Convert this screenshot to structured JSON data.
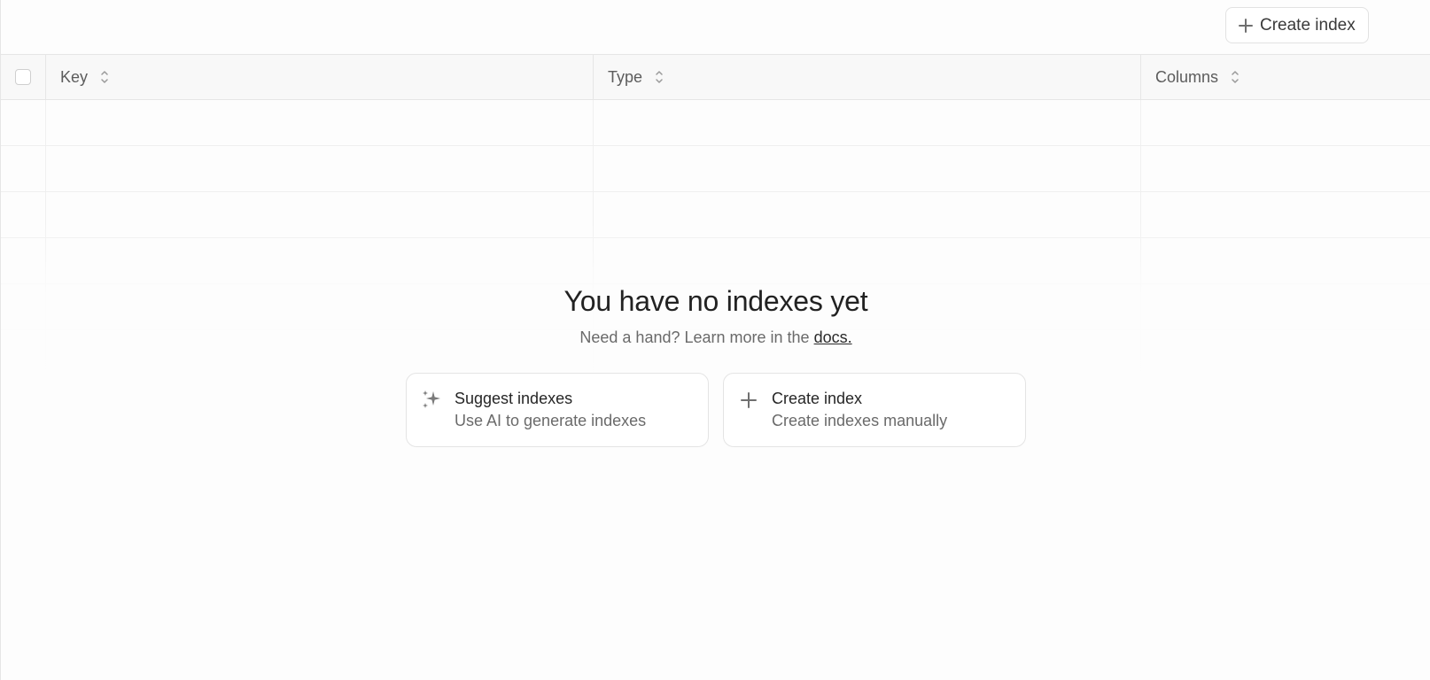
{
  "toolbar": {
    "create_index_label": "Create index",
    "create_index_icon": "plus-icon"
  },
  "table": {
    "columns": [
      {
        "label": "Key",
        "sort_icon": "sort-icon"
      },
      {
        "label": "Type",
        "sort_icon": "sort-icon"
      },
      {
        "label": "Columns",
        "sort_icon": "sort-icon"
      }
    ],
    "rows": []
  },
  "empty_state": {
    "title": "You have no indexes yet",
    "subtitle_prefix": "Need a hand? Learn more in the ",
    "docs_link": "docs.",
    "cards": [
      {
        "title": "Suggest indexes",
        "description": "Use AI to generate indexes",
        "icon": "sparkles-icon"
      },
      {
        "title": "Create index",
        "description": "Create indexes manually",
        "icon": "plus-icon"
      }
    ]
  },
  "colors": {
    "border": "#e6e6e6",
    "header_bg": "#f8f8f8",
    "text_muted": "#6a6a6a",
    "text_primary": "#222222"
  }
}
